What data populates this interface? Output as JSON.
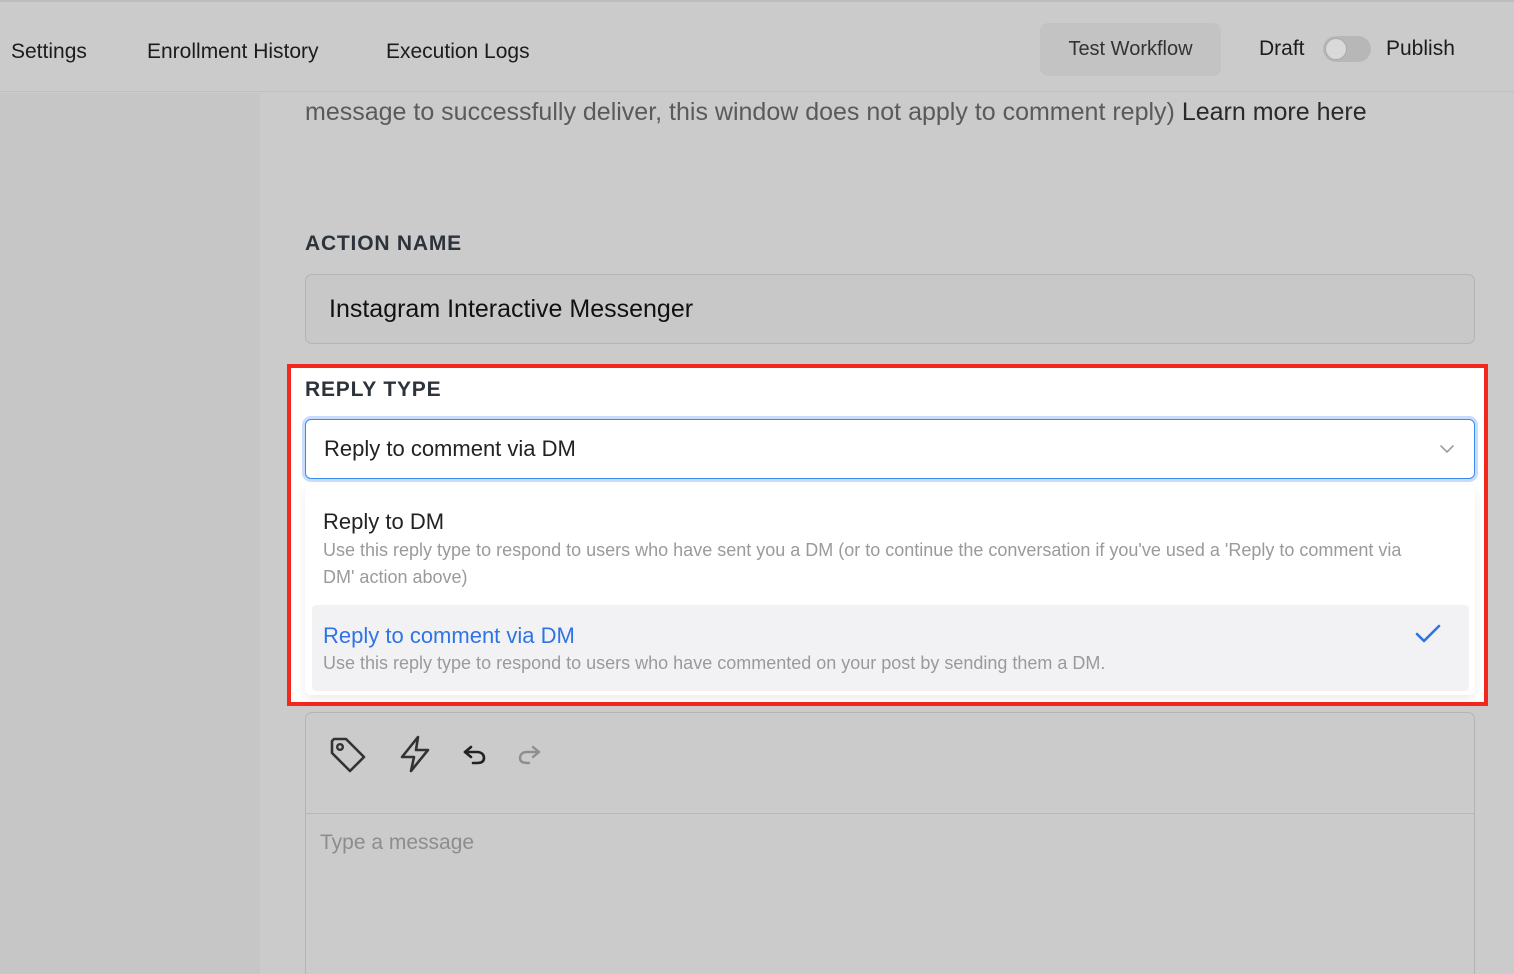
{
  "nav": {
    "tabs": [
      {
        "label": "Settings"
      },
      {
        "label": "Enrollment History"
      },
      {
        "label": "Execution Logs"
      }
    ],
    "test_button": "Test Workflow",
    "draft_label": "Draft",
    "publish_label": "Publish",
    "publish_toggle_on": false
  },
  "info": {
    "text": "message to successfully deliver, this window does not apply to comment reply)",
    "link": "Learn more here"
  },
  "action_name": {
    "label": "ACTION NAME",
    "value": "Instagram Interactive Messenger"
  },
  "reply_type": {
    "label": "REPLY TYPE",
    "selected": "Reply to comment via DM",
    "options": [
      {
        "title": "Reply to DM",
        "description": "Use this reply type to respond to users who have sent you a DM (or to continue the conversation if you've used a 'Reply to comment via DM' action above)"
      },
      {
        "title": "Reply to comment via DM",
        "description": "Use this reply type to respond to users who have commented on your post by sending them a DM."
      }
    ]
  },
  "editor": {
    "placeholder": "Type a message"
  },
  "colors": {
    "highlight": "#f2281d",
    "accent": "#2f74e6",
    "overlay": "#cbcbcb"
  },
  "icons": [
    "tag-icon",
    "lightning-icon",
    "undo-icon",
    "redo-icon",
    "chevron-down-icon",
    "checkmark-icon"
  ]
}
